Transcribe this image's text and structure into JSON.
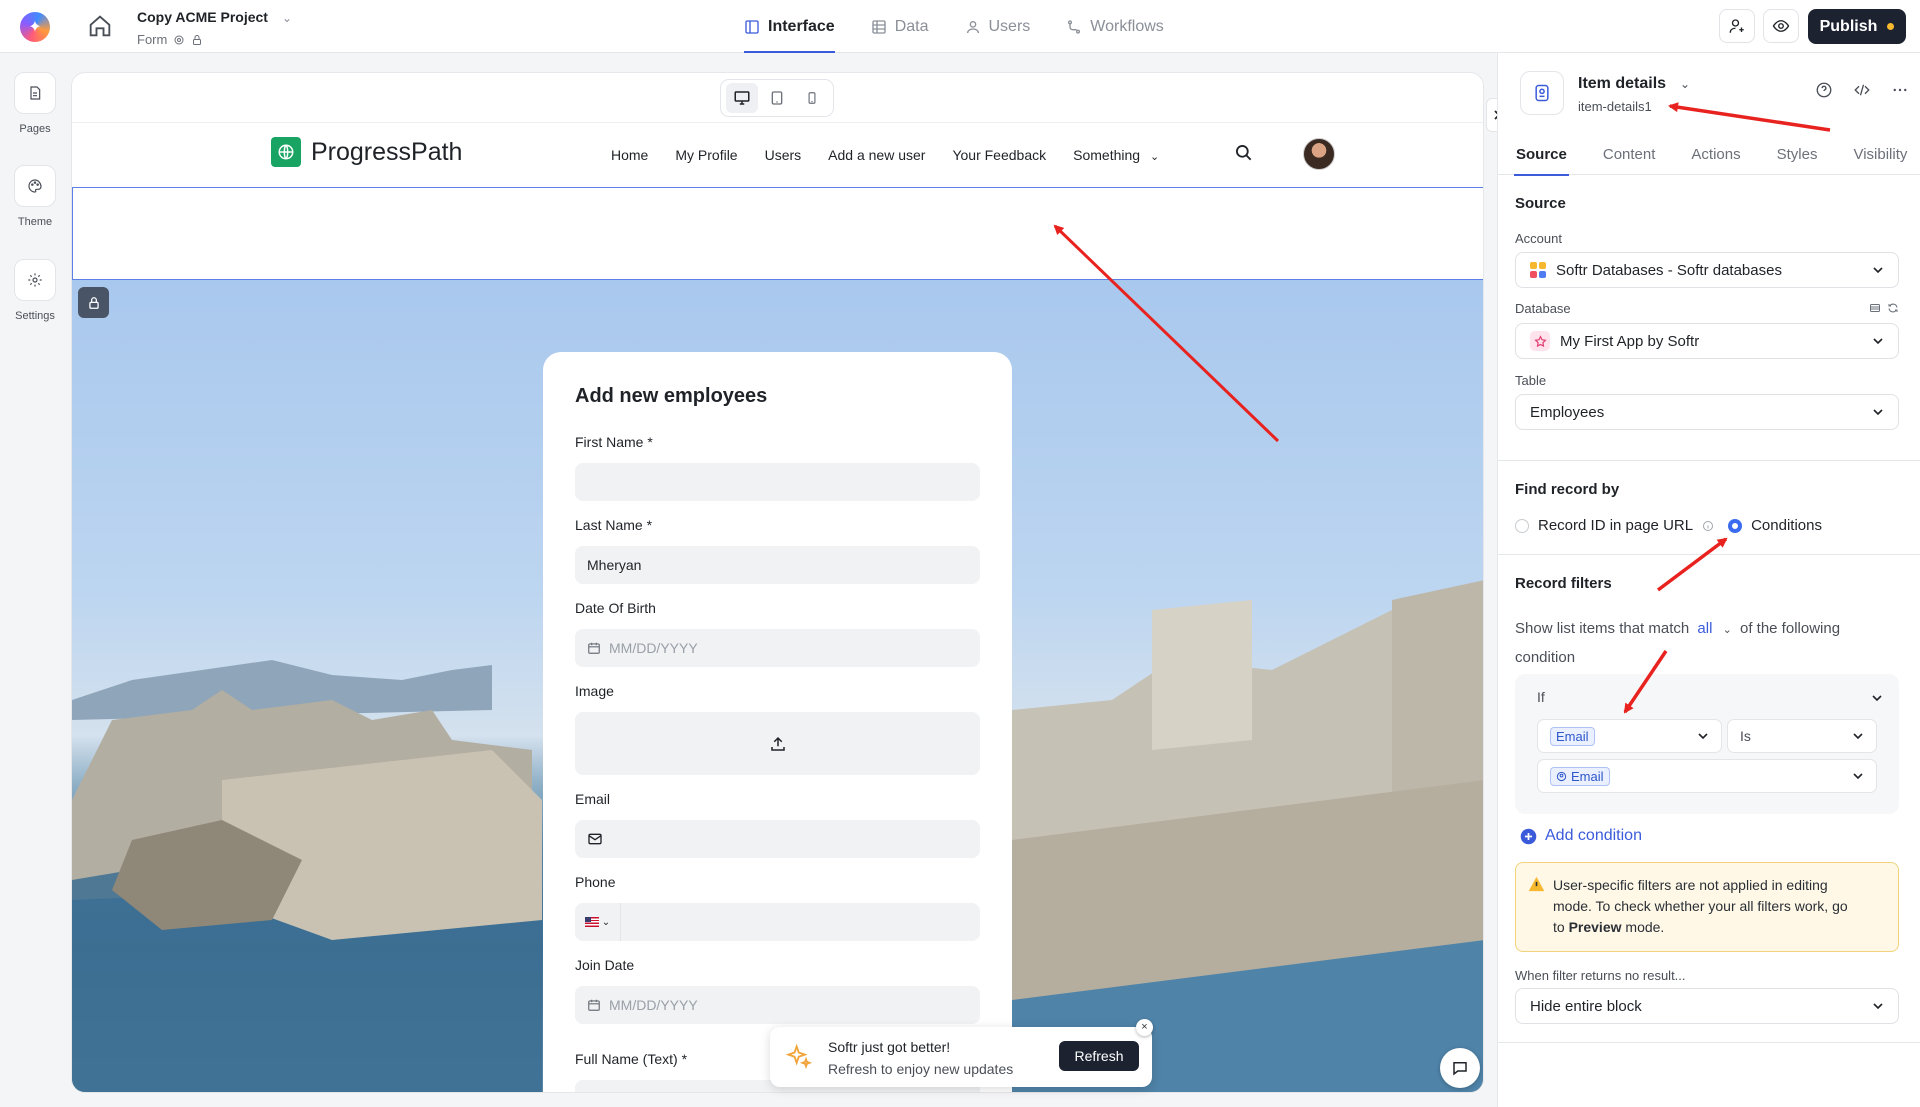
{
  "topbar": {
    "project_title": "Copy ACME Project",
    "project_sub": "Form",
    "tabs": [
      {
        "label": "Interface",
        "active": true
      },
      {
        "label": "Data"
      },
      {
        "label": "Users"
      },
      {
        "label": "Workflows"
      }
    ],
    "publish_label": "Publish",
    "accent": "#3b5bdb"
  },
  "rail": {
    "items": [
      {
        "label": "Pages",
        "icon": "page-icon"
      },
      {
        "label": "Theme",
        "icon": "palette-icon"
      },
      {
        "label": "Settings",
        "icon": "gear-icon"
      }
    ]
  },
  "site": {
    "brand": "ProgressPath",
    "nav": [
      "Home",
      "My Profile",
      "Users",
      "Add a new user",
      "Your Feedback",
      "Something"
    ]
  },
  "form": {
    "title": "Add new employees",
    "fields": [
      {
        "label": "First Name",
        "required": true,
        "value": "",
        "placeholder": ""
      },
      {
        "label": "Last Name",
        "required": true,
        "value": "Mheryan"
      },
      {
        "label": "Date Of Birth",
        "placeholder": "MM/DD/YYYY"
      },
      {
        "label": "Image"
      },
      {
        "label": "Email"
      },
      {
        "label": "Phone"
      },
      {
        "label": "Join Date",
        "placeholder": "MM/DD/YYYY"
      },
      {
        "label": "Full Name (Text)",
        "required": true
      }
    ],
    "required_mark": "*"
  },
  "toast": {
    "title": "Softr just got better!",
    "subtitle": "Refresh to enjoy new updates",
    "button": "Refresh",
    "close": "×"
  },
  "panel": {
    "title": "Item details",
    "subtitle": "item-details1",
    "tabs": [
      "Source",
      "Content",
      "Actions",
      "Styles",
      "Visibility"
    ],
    "source_heading": "Source",
    "account_label": "Account",
    "account_value": "Softr Databases - Softr databases",
    "database_label": "Database",
    "database_value": "My First App by Softr",
    "table_label": "Table",
    "table_value": "Employees",
    "find_heading": "Find record by",
    "radio_url": "Record ID in page URL",
    "radio_conditions": "Conditions",
    "selected": "Conditions",
    "filters_heading": "Record filters",
    "match_pre": "Show list items that match",
    "match_value": "all",
    "match_post": "of the following",
    "match_post2": "condition",
    "if_label": "If",
    "field_chip": "Email",
    "operator": "Is",
    "value_chip": "Email",
    "add_condition": "Add condition",
    "warning_1": "User-specific filters are not applied in editing",
    "warning_2": "mode. To check whether your all filters work, go",
    "warning_3a": "to",
    "warning_3b": "Preview",
    "warning_3c": "mode.",
    "no_result_label": "When filter returns no result...",
    "no_result_value": "Hide entire block"
  }
}
